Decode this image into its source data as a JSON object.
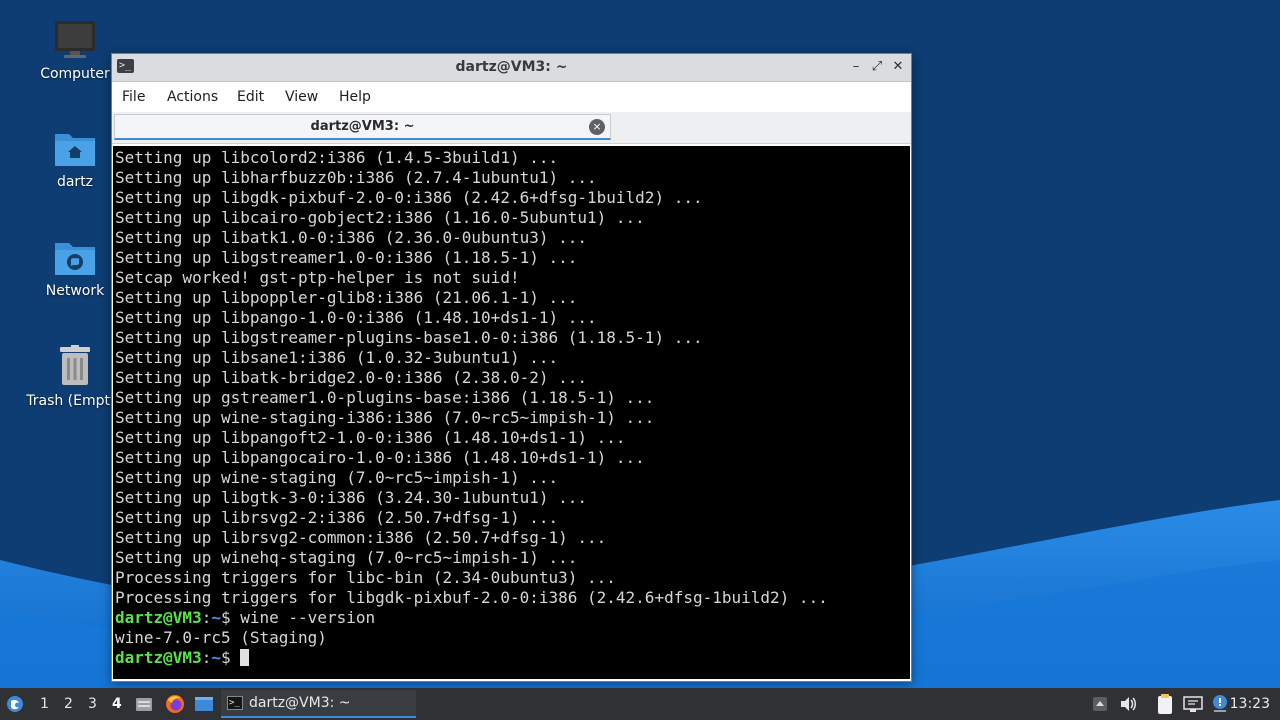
{
  "desktop": {
    "icons": [
      {
        "label": "Computer",
        "icon": "computer-icon"
      },
      {
        "label": "dartz",
        "icon": "home-folder-icon"
      },
      {
        "label": "Network",
        "icon": "network-folder-icon"
      },
      {
        "label": "Trash (Empty)",
        "icon": "trash-icon"
      }
    ]
  },
  "window": {
    "title": "dartz@VM3: ~",
    "controls": {
      "minimize": "–",
      "maximize": "⤢",
      "close": "✕"
    },
    "menu": [
      "File",
      "Actions",
      "Edit",
      "View",
      "Help"
    ],
    "tab": {
      "title": "dartz@VM3: ~",
      "close": "×"
    }
  },
  "terminal": {
    "lines": [
      "Setting up libcolord2:i386 (1.4.5-3build1) ...",
      "Setting up libharfbuzz0b:i386 (2.7.4-1ubuntu1) ...",
      "Setting up libgdk-pixbuf-2.0-0:i386 (2.42.6+dfsg-1build2) ...",
      "Setting up libcairo-gobject2:i386 (1.16.0-5ubuntu1) ...",
      "Setting up libatk1.0-0:i386 (2.36.0-0ubuntu3) ...",
      "Setting up libgstreamer1.0-0:i386 (1.18.5-1) ...",
      "Setcap worked! gst-ptp-helper is not suid!",
      "Setting up libpoppler-glib8:i386 (21.06.1-1) ...",
      "Setting up libpango-1.0-0:i386 (1.48.10+ds1-1) ...",
      "Setting up libgstreamer-plugins-base1.0-0:i386 (1.18.5-1) ...",
      "Setting up libsane1:i386 (1.0.32-3ubuntu1) ...",
      "Setting up libatk-bridge2.0-0:i386 (2.38.0-2) ...",
      "Setting up gstreamer1.0-plugins-base:i386 (1.18.5-1) ...",
      "Setting up wine-staging-i386:i386 (7.0~rc5~impish-1) ...",
      "Setting up libpangoft2-1.0-0:i386 (1.48.10+ds1-1) ...",
      "Setting up libpangocairo-1.0-0:i386 (1.48.10+ds1-1) ...",
      "Setting up wine-staging (7.0~rc5~impish-1) ...",
      "Setting up libgtk-3-0:i386 (3.24.30-1ubuntu1) ...",
      "Setting up librsvg2-2:i386 (2.50.7+dfsg-1) ...",
      "Setting up librsvg2-common:i386 (2.50.7+dfsg-1) ...",
      "Setting up winehq-staging (7.0~rc5~impish-1) ...",
      "Processing triggers for libc-bin (2.34-0ubuntu3) ...",
      "Processing triggers for libgdk-pixbuf-2.0-0:i386 (2.42.6+dfsg-1build2) ..."
    ],
    "prompt_user": "dartz@VM3",
    "prompt_sep": ":",
    "prompt_dir": "~",
    "prompt_sign": "$ ",
    "command": "wine --version",
    "output": "wine-7.0-rc5 (Staging)"
  },
  "taskbar": {
    "workspaces": [
      "1",
      "2",
      "3",
      "4"
    ],
    "active_workspace": "4",
    "task_label": "dartz@VM3: ~",
    "clock": "13:23"
  },
  "colors": {
    "prompt_user": "#57e34a",
    "prompt_dir": "#5b8cf2",
    "accent": "#3e8ad6",
    "desktop_bg": "#0d3d73"
  }
}
